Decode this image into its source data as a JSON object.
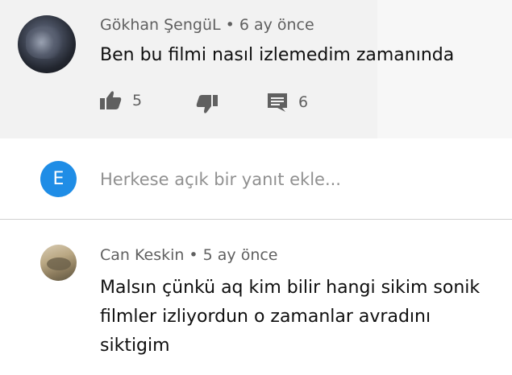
{
  "comment1": {
    "author": "Gökhan ŞengüL",
    "separator": "•",
    "time": "6 ay önce",
    "text": "Ben bu filmi nasıl izlemedim zamanında",
    "likes": "5",
    "replies": "6"
  },
  "reply_box": {
    "avatar_letter": "E",
    "placeholder": "Herkese açık bir yanıt ekle..."
  },
  "comment2": {
    "author": "Can Keskin",
    "separator": "•",
    "time": "5 ay önce",
    "text": "Malsın çünkü aq kim bilir hangi sikim sonik filmler izliyordun o zamanlar avradını siktigim"
  },
  "colors": {
    "meta_text": "#606060",
    "body_text": "#0f0f0f",
    "avatar_accent": "#1f8de6"
  }
}
